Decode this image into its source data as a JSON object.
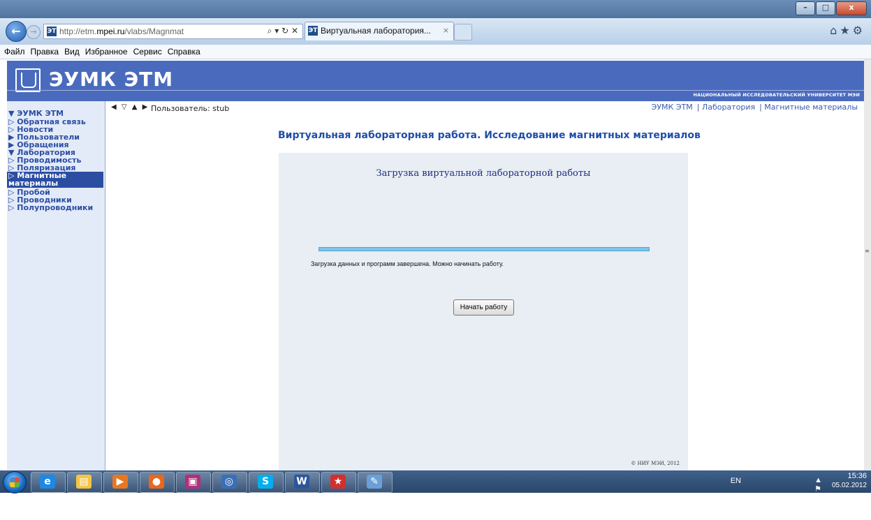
{
  "browser": {
    "address_prefix": "http://etm.",
    "address_domain": "mpei.ru",
    "address_path": "/vlabs/Magnmat",
    "address_tools": "⌕ ▾ ↻ ✕",
    "tab_title": "Виртуальная лаборатория...",
    "tab_close": "×",
    "favicon": "ЭТ"
  },
  "window_buttons": {
    "minimize": "–",
    "maximize": "□",
    "close": "x"
  },
  "menubar": {
    "items": [
      "Файл",
      "Правка",
      "Вид",
      "Избранное",
      "Сервис",
      "Справка"
    ]
  },
  "header": {
    "logo_text": "ЭУМК ЭТМ",
    "university": "НАЦИОНАЛЬНЫЙ ИССЛЕДОВАТЕЛЬСКИЙ УНИВЕРСИТЕТ МЭИ"
  },
  "sidebar": {
    "root": "▼ ЭУМК ЭТМ",
    "items": [
      "▷ Обратная связь",
      "▷ Новости",
      "▶ Пользователи",
      "▶ Обращения",
      "▼ Лаборатория",
      "▷ Проводимость",
      "▷ Поляризация",
      "▷ Магнитные",
      "материалы",
      "▷ Пробой",
      "▷ Проводники",
      "▷ Полупроводники"
    ],
    "active_index": 7
  },
  "main": {
    "nav_arrows": "◀ ▽ ▲ ▶",
    "user_label": "Пользователь: stub",
    "breadcrumbs": [
      "ЭУМК ЭТМ",
      "| Лаборатория",
      "| Магнитные материалы"
    ],
    "heading": "Виртуальная лабораторная работа. Исследование магнитных материалов",
    "panel_title": "Загрузка виртуальной лабораторной работы",
    "progress_fraction": 1.0,
    "status_text": "Загрузка данных и программ завершена. Можно начинать работу.",
    "start_button": "Начать работу",
    "copyright": "© НИУ МЭИ, 2012"
  },
  "taskbar": {
    "apps": [
      "ie-icon",
      "explorer-icon",
      "media-player-icon",
      "firefox-icon",
      "save-icon",
      "network-icon",
      "skype-icon",
      "word-icon",
      "acrobat-icon",
      "paint-icon"
    ],
    "app_glyphs": [
      "e",
      "▤",
      "▶",
      "●",
      "▣",
      "◎",
      "S",
      "W",
      "★",
      "✎"
    ],
    "app_colors": [
      "#1e88e5",
      "#f4c542",
      "#e87722",
      "#e8681c",
      "#b0307a",
      "#3a6fb5",
      "#00aff0",
      "#2b579a",
      "#d32f2f",
      "#6a9fd8"
    ],
    "lang": "EN",
    "tray_icons": "▲ ⚑ ☰ ▂ ♪",
    "time": "15:36",
    "date": "05.02.2012"
  }
}
